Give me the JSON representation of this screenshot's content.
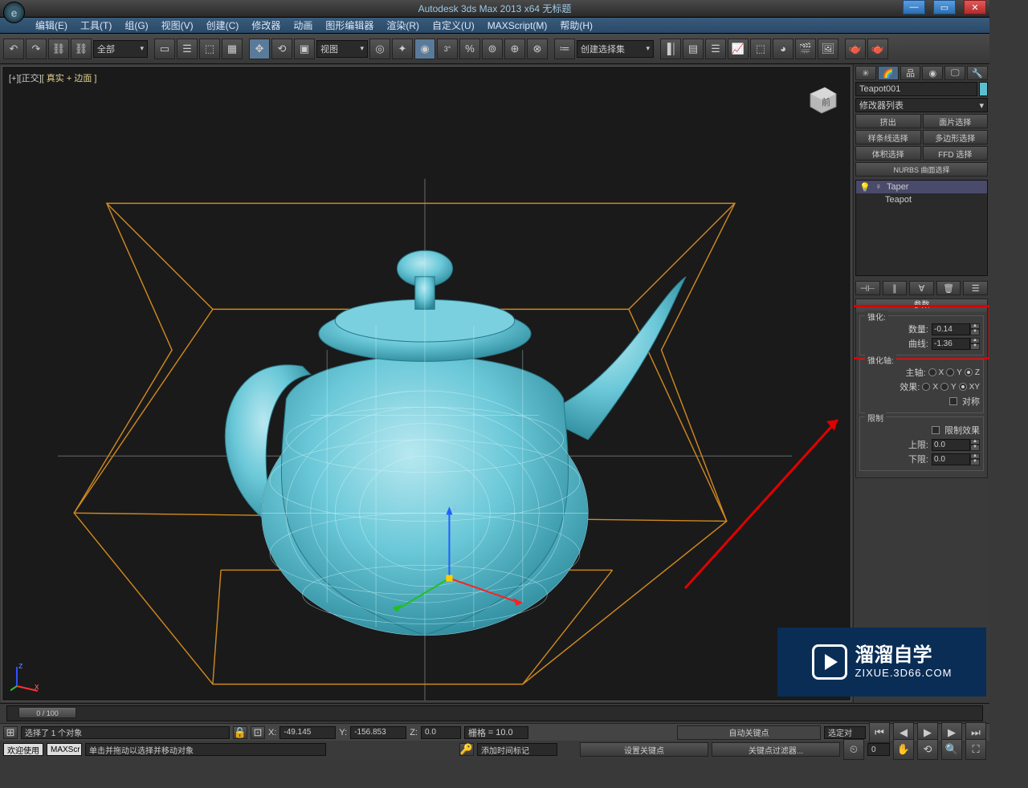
{
  "title": "Autodesk 3ds Max  2013 x64    无标题",
  "menu": [
    "编辑(E)",
    "工具(T)",
    "组(G)",
    "视图(V)",
    "创建(C)",
    "修改器",
    "动画",
    "图形编辑器",
    "渲染(R)",
    "自定义(U)",
    "MAXScript(M)",
    "帮助(H)"
  ],
  "toolbar": {
    "filter": "全部",
    "ref": "视图",
    "createSet": "创建选择集"
  },
  "viewport": {
    "label_plus": "[+]",
    "label_view": "[正交]",
    "label_shading": "[ 真实 + 边面 ]"
  },
  "side": {
    "objName": "Teapot001",
    "modList": "修改器列表",
    "btns": [
      "挤出",
      "面片选择",
      "样条线选择",
      "多边形选择",
      "体积选择",
      "FFD 选择",
      "NURBS 曲面选择"
    ],
    "stack": [
      "Taper",
      "Teapot"
    ],
    "rollout": "参数",
    "grp_taper": "锥化:",
    "amount_lbl": "数量:",
    "amount_val": "-0.14",
    "curve_lbl": "曲线:",
    "curve_val": "-1.36",
    "grp_axis": "锥化轴:",
    "axis_p": "主轴:",
    "axis_e": "效果:",
    "sym": "对称",
    "grp_limit": "限制",
    "limit_chk": "限制效果",
    "upper_lbl": "上限:",
    "upper_val": "0.0",
    "lower_lbl": "下限:",
    "lower_val": "0.0"
  },
  "timeline": {
    "pos": "0 / 100"
  },
  "status": {
    "sel": "选择了 1 个对象",
    "hint": "单击并拖动以选择并移动对象",
    "x_l": "X:",
    "x": "-49.145",
    "y_l": "Y:",
    "y": "-156.853",
    "z_l": "Z:",
    "z": "0.0",
    "grid_l": "栅格",
    "grid": "= 10.0",
    "autoKey": "自动关键点",
    "selSet": "选定对",
    "setKey": "设置关键点",
    "keyFilter": "关键点过滤器...",
    "addTag": "添加时间标记",
    "welcome": "欢迎使用",
    "maxscr": "MAXScr"
  },
  "watermark": {
    "brand": "溜溜自学",
    "url": "ZIXUE.3D66.COM"
  }
}
